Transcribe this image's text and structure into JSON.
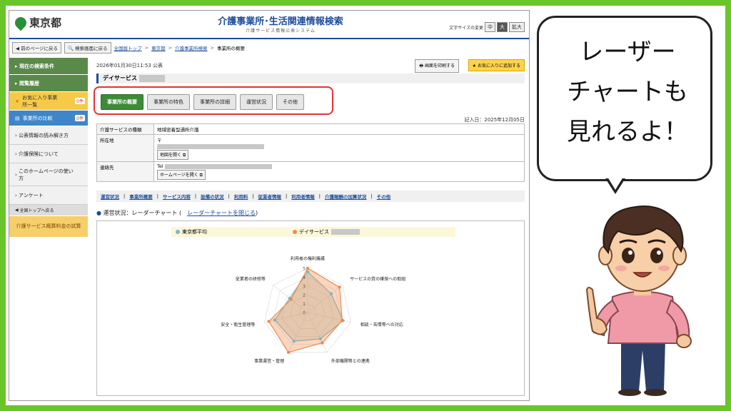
{
  "header": {
    "logo_text": "東京都",
    "title": "介護事業所･生活関連情報検索",
    "subtitle": "介護サービス情報公表システム",
    "font_size_label": "文字サイズの変更",
    "font_size_options": [
      "中",
      "大",
      "拡大"
    ]
  },
  "breadcrumb": {
    "back_label": "前のページに戻る",
    "search_back_label": "検索画面に戻る",
    "items": [
      "全国版トップ",
      "東京都",
      "介護事業所検索",
      "事業所の概要"
    ]
  },
  "sidebar": {
    "items": [
      {
        "label": "現在の検索条件"
      },
      {
        "label": "閲覧履歴"
      },
      {
        "label": "お気に入り事業所一覧",
        "count": "0件"
      },
      {
        "label": "事業所の比較",
        "count": "0件"
      },
      {
        "label": "公表情報の読み解き方"
      },
      {
        "label": "介護保険について"
      },
      {
        "label": "このホームページの使い方"
      },
      {
        "label": "アンケート"
      }
    ],
    "back_top": "全国トップへ戻る",
    "service_calc": "介護サービス概算料金の試算"
  },
  "main": {
    "published": "2026年01月30日11:53 公表",
    "print_label": "画面を印刷する",
    "fav_label": "お気に入りに追加する",
    "office_name": "デイサービス",
    "tabs": [
      "事業所の概要",
      "事業所の特色",
      "事業所の詳細",
      "運営状況",
      "その他"
    ],
    "entry_date": "記入日：2025年12月05日",
    "info": {
      "service_type_label": "介護サービスの種類",
      "service_type_value": "地域密着型通所介護",
      "address_label": "所在地",
      "address_prefix": "〒",
      "map_button": "地図を開く",
      "contact_label": "連絡先",
      "tel_prefix": "Tel",
      "hp_button": "ホームページを開く"
    },
    "nav": [
      "運営状況",
      "事業所概要",
      "サービス内容",
      "設備の状況",
      "利用料",
      "従業者情報",
      "利用者情報",
      "介護報酬の加算状況",
      "その他"
    ],
    "radar_title": "運営状況：レーダーチャート",
    "radar_close": "レーダーチャートを閉じる"
  },
  "chart_data": {
    "type": "radar",
    "axes": [
      "利用者の権利擁護",
      "サービスの質の確保への取組",
      "相談・苦情等への対応",
      "外部機関等との連携",
      "事業運営・管理",
      "安全・衛生管理等",
      "従業者の研修等"
    ],
    "rlim": [
      0,
      5
    ],
    "ticks": [
      "0",
      "1",
      "2",
      "3",
      "4",
      "5"
    ],
    "series": [
      {
        "name": "東京都平均",
        "color": "#7ab8c6",
        "values": [
          4.6,
          3.4,
          4.1,
          3.3,
          3.6,
          3.8,
          2.6
        ]
      },
      {
        "name": "デイサービス",
        "color": "#f08a4b",
        "values": [
          5,
          4.6,
          4.0,
          3.8,
          5,
          4.5,
          2.4
        ]
      }
    ]
  },
  "bubble": {
    "lines": [
      "レーザー",
      "チャートも",
      "見れるよ！"
    ]
  }
}
